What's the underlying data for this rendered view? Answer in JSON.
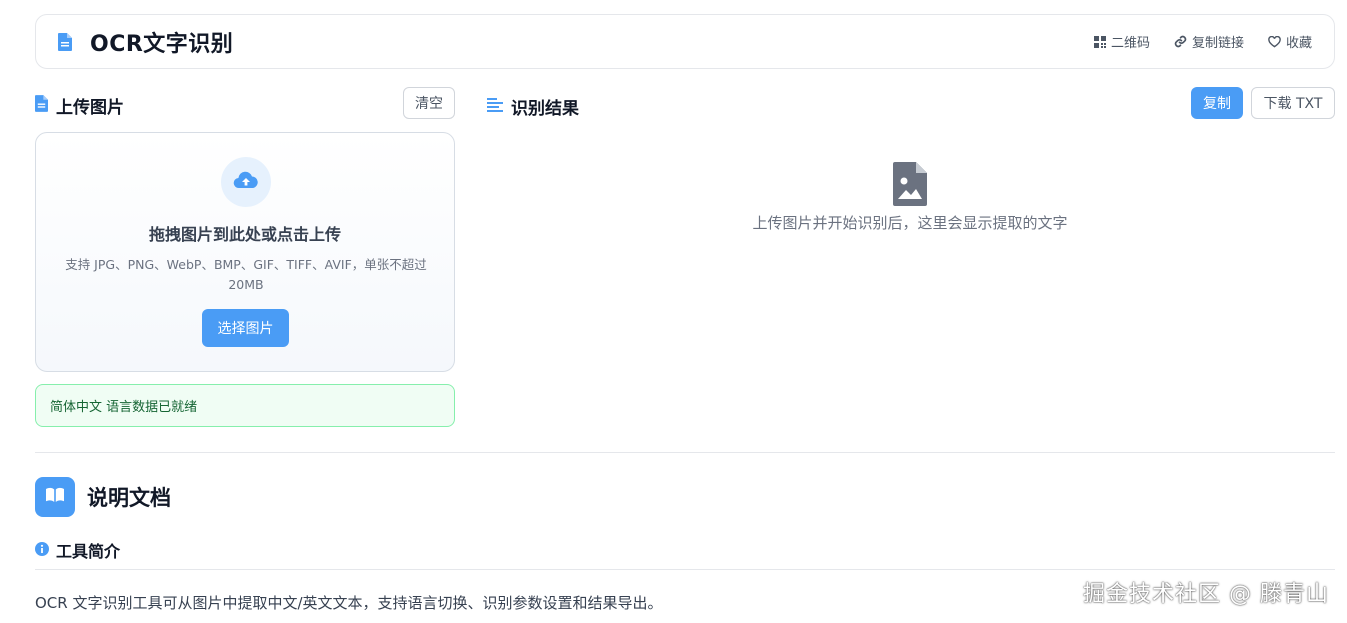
{
  "header": {
    "title": "OCR文字识别",
    "actions": [
      {
        "label": "二维码",
        "icon": "qrcode-icon"
      },
      {
        "label": "复制链接",
        "icon": "link-icon"
      },
      {
        "label": "收藏",
        "icon": "heart-icon"
      }
    ]
  },
  "upload_section": {
    "title": "上传图片",
    "clear_label": "清空",
    "drop_title": "拖拽图片到此处或点击上传",
    "drop_desc": "支持 JPG、PNG、WebP、BMP、GIF、TIFF、AVIF，单张不超过 20MB",
    "choose_label": "选择图片",
    "status_text": "简体中文 语言数据已就绪"
  },
  "result_section": {
    "title": "识别结果",
    "copy_label": "复制",
    "download_label": "下载 TXT",
    "empty_text": "上传图片并开始识别后，这里会显示提取的文字"
  },
  "docs": {
    "title": "说明文档",
    "intro_title": "工具简介",
    "intro_text": "OCR 文字识别工具可从图片中提取中文/英文文本，支持语言切换、识别参数设置和结果导出。"
  },
  "watermark": "掘金技术社区 @ 滕青山",
  "colors": {
    "accent": "#4a9cf5",
    "success_bg": "#f0fdf4",
    "success_border": "#86efac",
    "success_text": "#166534"
  }
}
